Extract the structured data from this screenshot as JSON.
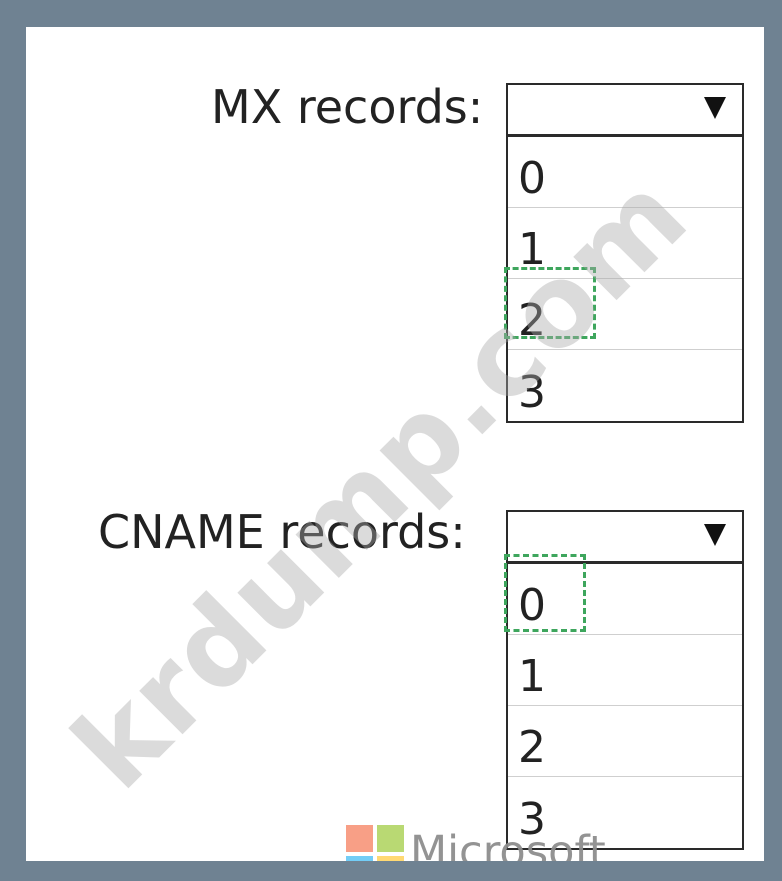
{
  "mx": {
    "label": "MX records:",
    "options": [
      "0",
      "1",
      "2",
      "3"
    ],
    "marked_option": "2"
  },
  "cname": {
    "label": "CNAME records:",
    "options": [
      "0",
      "1",
      "2",
      "3"
    ],
    "marked_option": "0"
  },
  "watermark": "krdump.com",
  "footer": {
    "brand": "Microsoft"
  },
  "colors": {
    "frame": "#6f8292",
    "answer_marker": "#3ea65d",
    "ms_red": "#f25022",
    "ms_green": "#7fba00",
    "ms_blue": "#00a4ef",
    "ms_yellow": "#ffb900"
  },
  "icons": {
    "dropdown": "triangle-down-icon",
    "brand": "microsoft-logo-icon"
  }
}
